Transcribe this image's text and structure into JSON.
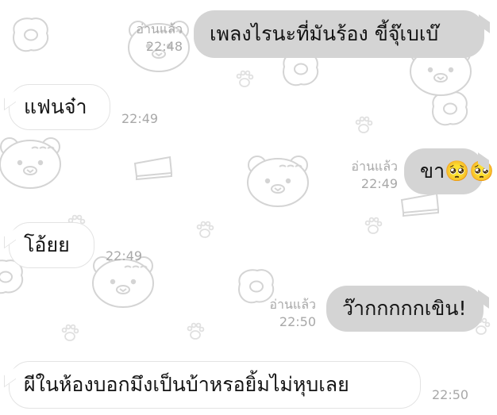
{
  "colors": {
    "background": "#ffffff",
    "incoming_bubble": "#ffffff",
    "outgoing_bubble": "#d4d4d4",
    "meta_text": "#a8a8a8",
    "message_text": "#141414",
    "doodle_stroke": "#d6d6d6"
  },
  "wallpaper": {
    "icons": [
      "fried-egg-icon",
      "bear-face-icon",
      "cake-slice-icon",
      "paw-print-icon"
    ]
  },
  "messages": [
    {
      "side": "outgoing",
      "text": "เพลงไรนะที่มันร้อง ขี้จุ๊เบเบ๊",
      "read": "อ่านแล้ว",
      "time": "22:48"
    },
    {
      "side": "incoming",
      "text": "แฟนจ๋า",
      "time": "22:49"
    },
    {
      "side": "outgoing",
      "text": "ขา🥺🥺",
      "read": "อ่านแล้ว",
      "time": "22:49"
    },
    {
      "side": "incoming",
      "text": "โอ้ยย",
      "time": "22:49"
    },
    {
      "side": "outgoing",
      "text": "ว๊ากกกกกเขิน!",
      "read": "อ่านแล้ว",
      "time": "22:50"
    },
    {
      "side": "incoming",
      "text": "ผีในห้องบอกมึงเป็นบ้าหรอยิ้มไม่หุบเลย",
      "time": "22:50"
    }
  ]
}
